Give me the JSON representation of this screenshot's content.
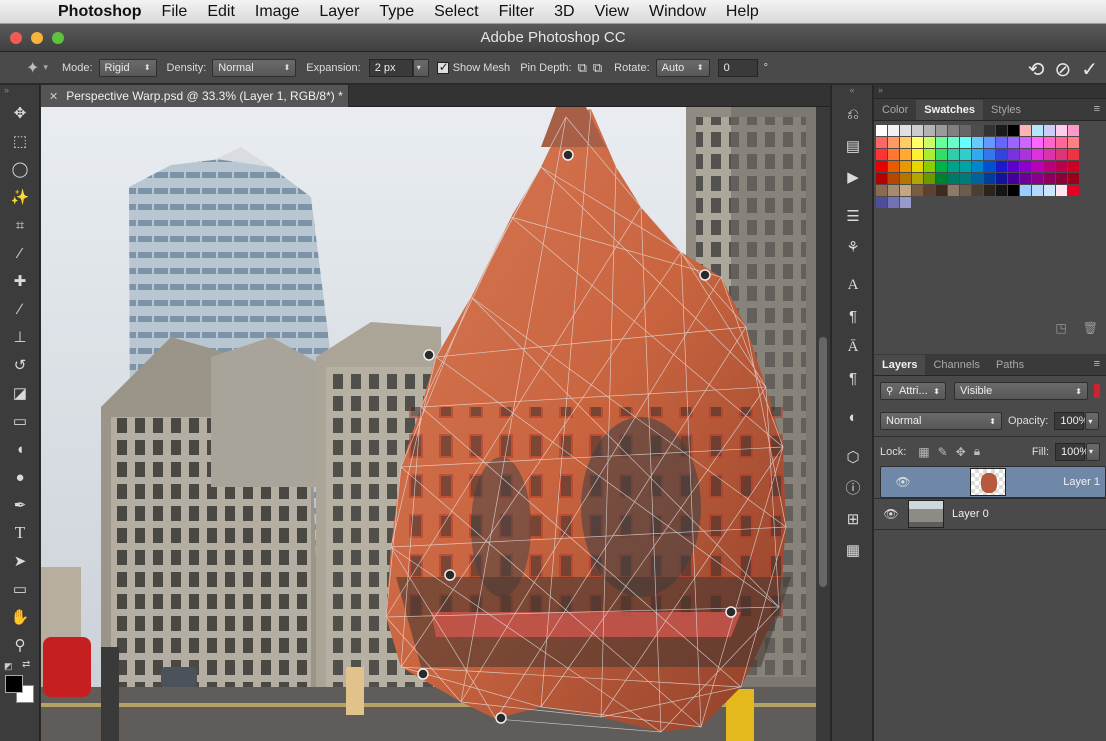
{
  "menubar": {
    "app": "Photoshop",
    "items": [
      "File",
      "Edit",
      "Image",
      "Layer",
      "Type",
      "Select",
      "Filter",
      "3D",
      "View",
      "Window",
      "Help"
    ]
  },
  "window": {
    "title": "Adobe Photoshop CC"
  },
  "options": {
    "mode_label": "Mode:",
    "mode_value": "Rigid",
    "density_label": "Density:",
    "density_value": "Normal",
    "expansion_label": "Expansion:",
    "expansion_value": "2 px",
    "show_mesh_label": "Show Mesh",
    "pin_depth_label": "Pin Depth:",
    "rotate_label": "Rotate:",
    "rotate_value": "Auto",
    "angle_value": "0",
    "angle_unit": "°"
  },
  "document": {
    "tab_title": "Perspective Warp.psd @ 33.3% (Layer 1, RGB/8*) *"
  },
  "swatches_panel": {
    "tabs": [
      "Color",
      "Swatches",
      "Styles"
    ],
    "active_tab": "Swatches",
    "rows": [
      [
        "#ffffff",
        "#f2f2f2",
        "#e0e0e0",
        "#cccccc",
        "#b3b3b3",
        "#9a9a9a",
        "#808080",
        "#666666",
        "#4d4d4d",
        "#333333",
        "#1a1a1a",
        "#000000",
        "#ffb3b3",
        "#b3e6ff",
        "#ccccff",
        "#ffccee",
        "#ff99cc"
      ],
      [
        "#ff6666",
        "#ff9966",
        "#ffcc66",
        "#ffff66",
        "#ccff66",
        "#66ff99",
        "#66ffcc",
        "#66ffff",
        "#66ccff",
        "#6699ff",
        "#6666ff",
        "#9966ff",
        "#cc66ff",
        "#ff66ff",
        "#ff66cc",
        "#ff6699",
        "#ff8080"
      ],
      [
        "#ff3333",
        "#ff7733",
        "#ffaa33",
        "#ffee33",
        "#aaee33",
        "#33dd66",
        "#33ccaa",
        "#33cccc",
        "#33aaee",
        "#3377ee",
        "#3344dd",
        "#7733dd",
        "#aa33dd",
        "#dd33dd",
        "#dd33aa",
        "#dd3377",
        "#ee3344"
      ],
      [
        "#e60000",
        "#e65c00",
        "#e69900",
        "#e6d600",
        "#8ccc00",
        "#00b347",
        "#00a38a",
        "#00a3a3",
        "#0086cc",
        "#0052cc",
        "#1a1acc",
        "#5c00cc",
        "#8c00cc",
        "#b800b8",
        "#b8007a",
        "#b8004d",
        "#cc0022"
      ],
      [
        "#b30000",
        "#b34700",
        "#b37700",
        "#b3a600",
        "#6b9900",
        "#00802f",
        "#007a66",
        "#007a7a",
        "#006399",
        "#003d99",
        "#141499",
        "#440099",
        "#6b0099",
        "#8a008a",
        "#8a005c",
        "#8a0039",
        "#990019"
      ],
      [
        "#8a6b52",
        "#a68b6e",
        "#c4a684",
        "#7a5c3e",
        "#5c4030",
        "#3d2b1f",
        "#8c7a66",
        "#6b5c4d",
        "#4a3f33",
        "#2b241c",
        "#141414",
        "#000000",
        "#99ccff",
        "#b3d9ff",
        "#cce6ff",
        "#ffe6f0",
        "#e60026"
      ],
      [
        "#4d4d99",
        "#7373b3",
        "#9999cc"
      ]
    ]
  },
  "layers_panel": {
    "tabs": [
      "Layers",
      "Channels",
      "Paths"
    ],
    "active_tab": "Layers",
    "filter_value": "Attri...",
    "visibility_filter": "Visible",
    "blend_mode": "Normal",
    "opacity_label": "Opacity:",
    "opacity_value": "100%",
    "lock_label": "Lock:",
    "fill_label": "Fill:",
    "fill_value": "100%",
    "layers": [
      {
        "name": "Layer 1",
        "selected": true
      },
      {
        "name": "Layer 0",
        "selected": false
      }
    ]
  }
}
